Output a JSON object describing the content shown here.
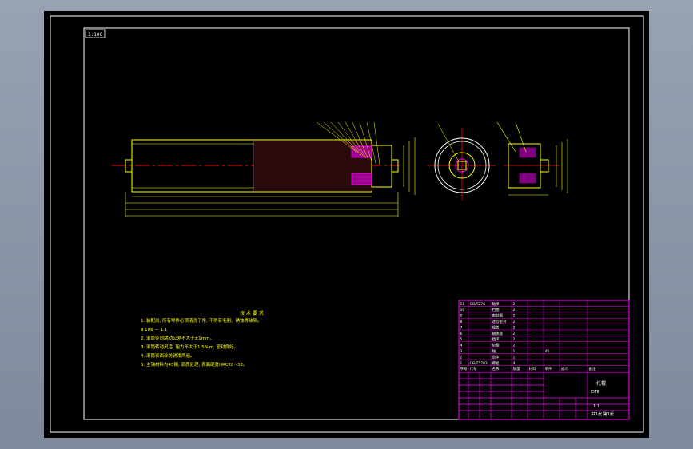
{
  "drawing": {
    "stamp": "1:100",
    "background": "#000000",
    "colors": {
      "frame": "#ffffff",
      "outline": "#ffff00",
      "section": "#ff00ff",
      "centerline": "#ff0000",
      "dimension": "#ffff00",
      "title_block": "#ff00ff"
    }
  },
  "notes": {
    "heading": "技 术 要 求",
    "lines": [
      "1. 装配前, 所有零件必须清洗干净, 不得有毛刺、锈蚀等缺陷。",
      "   ø 108 — 1.1",
      "2. 滚筒径向跳动公差不大于±1mm。",
      "3. 滚筒转动灵活, 阻力不大于1.5N·m, 密封良好。",
      "4. 滚筒表面涂防锈漆两遍。",
      "5. 主轴材料为45钢, 调质处理, 表面硬度HRC28~32。"
    ]
  },
  "title_block": {
    "parts_rows": [
      [
        "11",
        "GB/T276",
        "轴承",
        "2",
        "",
        "",
        "",
        ""
      ],
      [
        "10",
        "",
        "挡圈",
        "2",
        "",
        "",
        "",
        ""
      ],
      [
        "9",
        "",
        "密封圈",
        "2",
        "",
        "",
        "",
        ""
      ],
      [
        "8",
        "",
        "迷宫密封",
        "2",
        "",
        "",
        "",
        ""
      ],
      [
        "7",
        "",
        "端盖",
        "2",
        "",
        "",
        "",
        ""
      ],
      [
        "6",
        "",
        "轴承座",
        "2",
        "",
        "",
        "",
        ""
      ],
      [
        "5",
        "",
        "挡环",
        "2",
        "",
        "",
        "",
        ""
      ],
      [
        "4",
        "",
        "垫圈",
        "2",
        "",
        "",
        "",
        ""
      ],
      [
        "3",
        "",
        "轴",
        "1",
        "",
        "45",
        "",
        ""
      ],
      [
        "2",
        "",
        "筒体",
        "1",
        "",
        "",
        "",
        ""
      ],
      [
        "1",
        "GB/T5783",
        "螺栓",
        "4",
        "",
        "",
        "",
        ""
      ]
    ],
    "header_labels": [
      "序号",
      "代号",
      "名称",
      "数量",
      "材料",
      "单件",
      "总计",
      "备注"
    ],
    "title": "托辊",
    "drawing_number": "DTⅡ",
    "scale": "1:1",
    "sheet": "共1张 第1张"
  }
}
